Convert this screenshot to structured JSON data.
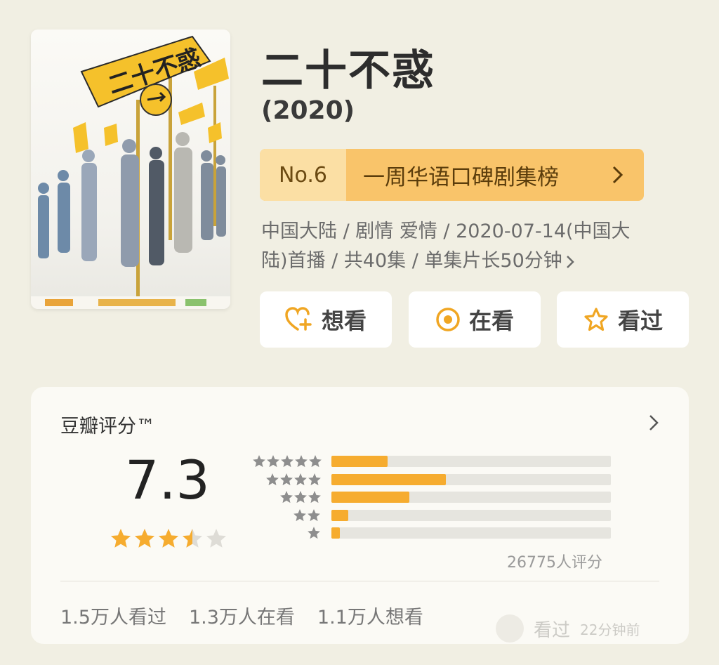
{
  "title": "二十不惑",
  "year": "(2020)",
  "rank": {
    "number": "No.6",
    "label": "一周华语口碑剧集榜"
  },
  "meta": {
    "line1": "中国大陆 / 剧情 爱情 / 2020-07-14(中国大",
    "line2": "陆)首播 / 共40集 / 单集片长50分钟"
  },
  "actions": {
    "want": "想看",
    "doing": "在看",
    "done": "看过"
  },
  "rating": {
    "label": "豆瓣评分™",
    "score": "7.3",
    "star_value": 3.5,
    "distribution": [
      {
        "stars": 5,
        "fraction": 0.2
      },
      {
        "stars": 4,
        "fraction": 0.41
      },
      {
        "stars": 3,
        "fraction": 0.28
      },
      {
        "stars": 2,
        "fraction": 0.06
      },
      {
        "stars": 1,
        "fraction": 0.03
      }
    ],
    "count": "26775人评分"
  },
  "stats": {
    "watched": "1.5万人看过",
    "watching": "1.3万人在看",
    "want": "1.1万人想看"
  },
  "overlay": {
    "label": "看过",
    "time": "22分钟前"
  },
  "colors": {
    "accent": "#f6ac2f",
    "rank_bg": "#f9c46a",
    "rank_no_bg": "#fbdfa4",
    "background": "#f1efe3"
  }
}
